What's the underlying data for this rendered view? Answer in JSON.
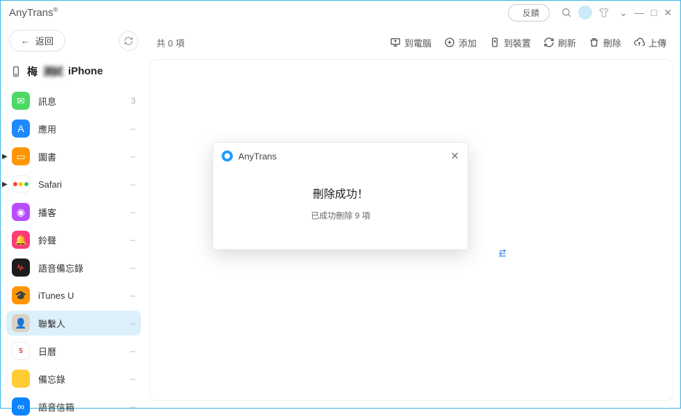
{
  "titlebar": {
    "brand": "AnyTrans",
    "feedback": "反饋"
  },
  "sidebar": {
    "back": "返回",
    "device_prefix": "梅",
    "device_suffix": "iPhone",
    "items": [
      {
        "label": "訊息",
        "count": "3"
      },
      {
        "label": "應用",
        "count": "--"
      },
      {
        "label": "圖書",
        "count": "--",
        "expandable": true
      },
      {
        "label": "Safari",
        "count": "--",
        "expandable": true
      },
      {
        "label": "播客",
        "count": "--"
      },
      {
        "label": "鈴聲",
        "count": "--"
      },
      {
        "label": "語音備忘錄",
        "count": "--"
      },
      {
        "label": "iTunes U",
        "count": "--"
      },
      {
        "label": "聯繫人",
        "count": "--",
        "active": true
      },
      {
        "label": "日曆",
        "count": "--"
      },
      {
        "label": "備忘錄",
        "count": "--"
      },
      {
        "label": "語音信箱",
        "count": "--"
      }
    ]
  },
  "toolbar": {
    "total": "共 0 項",
    "to_pc": "到電腦",
    "add": "添加",
    "to_device": "到裝置",
    "refresh": "刷新",
    "delete": "刪除",
    "upload": "上傳"
  },
  "modal": {
    "app": "AnyTrans",
    "title": "刪除成功！",
    "subtitle": "已成功刪除 9 項"
  },
  "calendar_day": "5"
}
